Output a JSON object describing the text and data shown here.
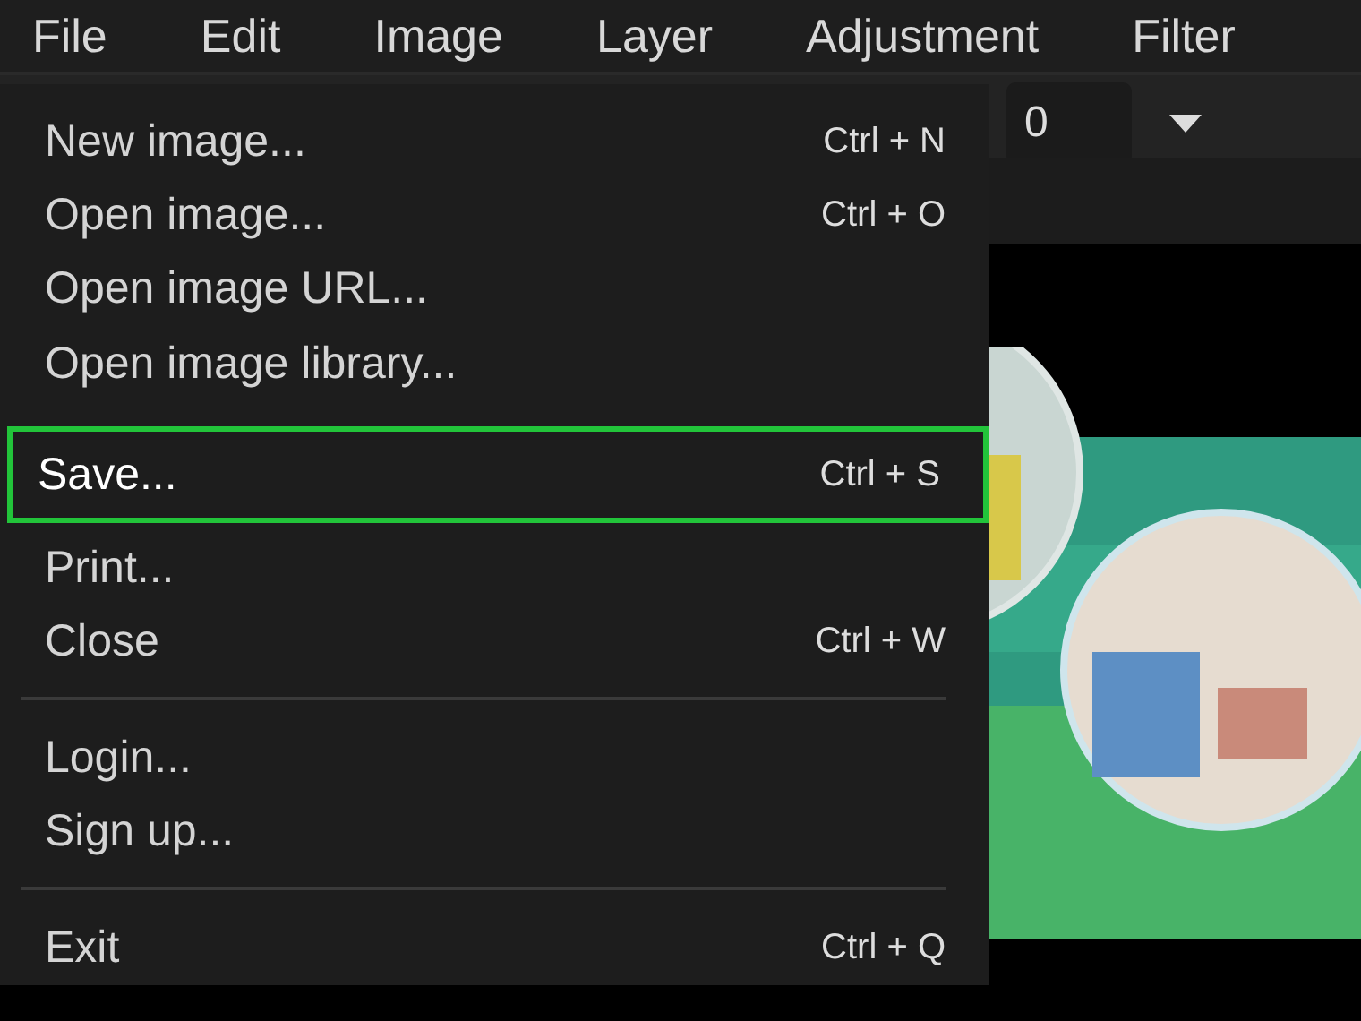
{
  "menu_bar": [
    {
      "label": "File"
    },
    {
      "label": "Edit"
    },
    {
      "label": "Image"
    },
    {
      "label": "Layer"
    },
    {
      "label": "Adjustment"
    },
    {
      "label": "Filter"
    }
  ],
  "toolbar": {
    "tolerance_value": "0"
  },
  "file_menu": [
    {
      "kind": "item",
      "label": "New image...",
      "shortcut": "Ctrl + N",
      "highlighted": false
    },
    {
      "kind": "item",
      "label": "Open image...",
      "shortcut": "Ctrl + O",
      "highlighted": false
    },
    {
      "kind": "item",
      "label": "Open image URL...",
      "highlighted": false
    },
    {
      "kind": "item",
      "label": "Open image library...",
      "highlighted": false
    },
    {
      "kind": "item",
      "label": "Save...",
      "shortcut": "Ctrl + S",
      "highlighted": true
    },
    {
      "kind": "item",
      "label": "Print...",
      "highlighted": false
    },
    {
      "kind": "item",
      "label": "Close",
      "shortcut": "Ctrl + W",
      "highlighted": false
    },
    {
      "kind": "separator"
    },
    {
      "kind": "item",
      "label": "Login...",
      "highlighted": false
    },
    {
      "kind": "item",
      "label": "Sign up...",
      "highlighted": false
    },
    {
      "kind": "separator"
    },
    {
      "kind": "item",
      "label": "Exit",
      "shortcut": "Ctrl + Q",
      "highlighted": false
    }
  ]
}
